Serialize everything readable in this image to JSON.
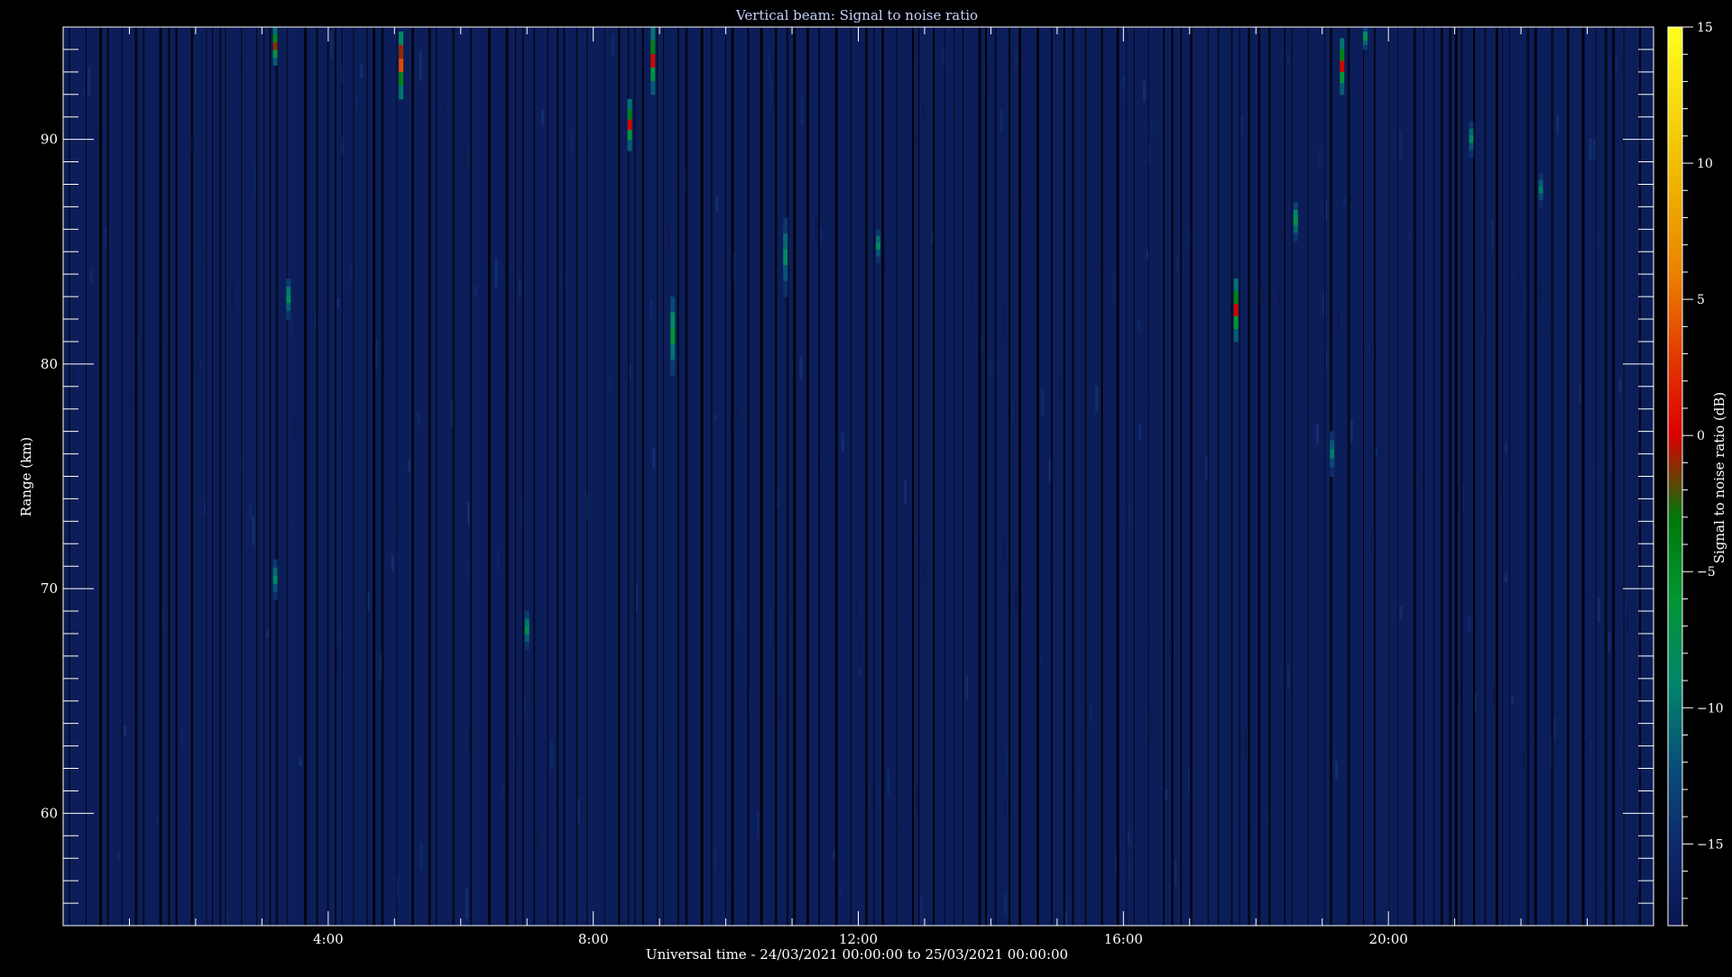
{
  "chart_data": {
    "type": "heatmap",
    "title": "Vertical beam: Signal to noise ratio",
    "xlabel": "Universal time - 24/03/2021 00:00:00 to 25/03/2021 00:00:00",
    "ylabel": "Range (km)",
    "colorbar_label": "Signal to noise ratio (dB)",
    "x_unit": "hours UT",
    "xlim": [
      0,
      24
    ],
    "ylim": [
      55,
      95
    ],
    "clim": [
      -18,
      15
    ],
    "x_ticks": [
      4,
      8,
      12,
      16,
      20
    ],
    "x_tick_labels": [
      "4:00",
      "8:00",
      "12:00",
      "16:00",
      "20:00"
    ],
    "y_ticks": [
      60,
      70,
      80,
      90
    ],
    "y_tick_labels": [
      "60",
      "70",
      "80",
      "90"
    ],
    "colorbar_ticks": [
      15,
      10,
      5,
      0,
      -5,
      -10,
      -15
    ],
    "colorbar_tick_labels": [
      "15",
      "10",
      "5",
      "0",
      "−5",
      "−10",
      "−15"
    ],
    "background_snr_db": -15,
    "strong_echoes": [
      {
        "time_hours": 3.2,
        "range_min_km": 93.3,
        "range_max_km": 95.0,
        "peak_snr_db": 0
      },
      {
        "time_hours": 3.2,
        "range_min_km": 69.5,
        "range_max_km": 71.3,
        "peak_snr_db": -8
      },
      {
        "time_hours": 3.4,
        "range_min_km": 82.0,
        "range_max_km": 83.8,
        "peak_snr_db": -7
      },
      {
        "time_hours": 5.1,
        "range_min_km": 91.8,
        "range_max_km": 94.8,
        "peak_snr_db": 5
      },
      {
        "time_hours": 7.0,
        "range_min_km": 67.3,
        "range_max_km": 69.0,
        "peak_snr_db": -7
      },
      {
        "time_hours": 8.55,
        "range_min_km": 89.5,
        "range_max_km": 91.8,
        "peak_snr_db": 1
      },
      {
        "time_hours": 8.9,
        "range_min_km": 92.0,
        "range_max_km": 95.0,
        "peak_snr_db": 1
      },
      {
        "time_hours": 9.2,
        "range_min_km": 79.5,
        "range_max_km": 83.0,
        "peak_snr_db": -5
      },
      {
        "time_hours": 10.9,
        "range_min_km": 83.0,
        "range_max_km": 86.5,
        "peak_snr_db": -8
      },
      {
        "time_hours": 12.3,
        "range_min_km": 84.5,
        "range_max_km": 86.0,
        "peak_snr_db": -8
      },
      {
        "time_hours": 17.7,
        "range_min_km": 81.0,
        "range_max_km": 83.8,
        "peak_snr_db": 1
      },
      {
        "time_hours": 18.6,
        "range_min_km": 85.5,
        "range_max_km": 87.2,
        "peak_snr_db": -6
      },
      {
        "time_hours": 19.15,
        "range_min_km": 75.0,
        "range_max_km": 77.0,
        "peak_snr_db": -9
      },
      {
        "time_hours": 19.3,
        "range_min_km": 92.0,
        "range_max_km": 94.5,
        "peak_snr_db": 1
      },
      {
        "time_hours": 19.65,
        "range_min_km": 94.0,
        "range_max_km": 95.0,
        "peak_snr_db": -6
      },
      {
        "time_hours": 21.25,
        "range_min_km": 89.2,
        "range_max_km": 90.8,
        "peak_snr_db": -8
      },
      {
        "time_hours": 22.3,
        "range_min_km": 87.0,
        "range_max_km": 88.5,
        "peak_snr_db": -9
      }
    ],
    "grid": false,
    "colormap": "dark blue - teal - green - red - orange - yellow",
    "colors": {
      "background": "#000000",
      "frame": "#ffffff",
      "title": "#c8d0ff",
      "noise": "#0c1e5a"
    }
  }
}
